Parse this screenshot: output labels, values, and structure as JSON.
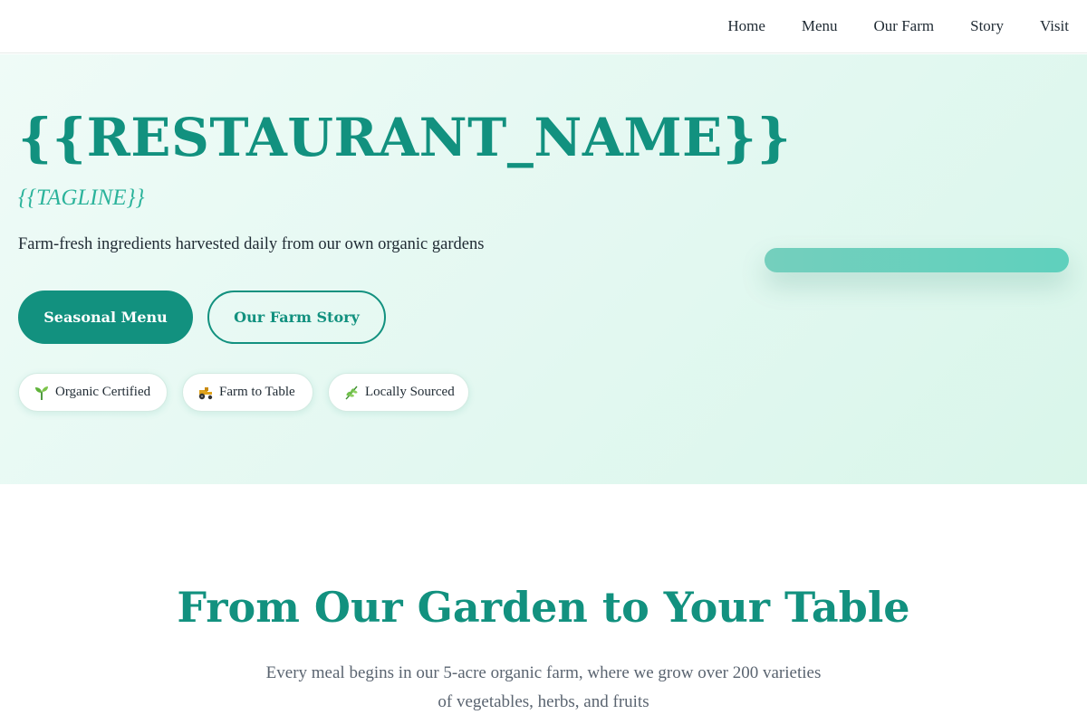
{
  "nav": {
    "items": [
      {
        "label": "Home"
      },
      {
        "label": "Menu"
      },
      {
        "label": "Our Farm"
      },
      {
        "label": "Story"
      },
      {
        "label": "Visit"
      }
    ]
  },
  "hero": {
    "title": "{{RESTAURANT_NAME}}",
    "tagline": "{{TAGLINE}}",
    "description": "Farm-fresh ingredients harvested daily from our own organic gardens",
    "primary_button": "Seasonal Menu",
    "secondary_button": "Our Farm Story",
    "badges": [
      {
        "icon": "seedling-icon",
        "label": "Organic Certified"
      },
      {
        "icon": "tractor-icon",
        "label": "Farm to Table"
      },
      {
        "icon": "herb-icon",
        "label": "Locally Sourced"
      }
    ]
  },
  "section": {
    "title": "From Our Garden to Your Table",
    "text": "Every meal begins in our 5-acre organic farm, where we grow over 200 varieties of vegetables, herbs, and fruits"
  },
  "colors": {
    "brand": "#12917f",
    "accent": "#2bb39b",
    "hero_bg": "#e3f8f1"
  }
}
